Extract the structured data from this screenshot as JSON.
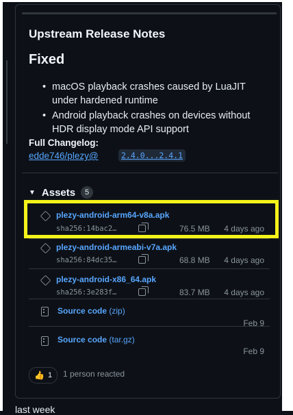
{
  "release": {
    "section_title": "Upstream Release Notes",
    "fixed_heading": "Fixed",
    "fixes": [
      "macOS playback crashes caused by LuaJIT under hardened runtime",
      "Android playback crashes on devices without HDR display mode API support"
    ],
    "changelog_label": "Full Changelog:",
    "changelog_repo": "edde746/plezy@",
    "changelog_compare": "2.4.0...2.4.1"
  },
  "assets": {
    "title": "Assets",
    "count": "5",
    "items": [
      {
        "name": "plezy-android-arm64-v8a.apk",
        "sha": "sha256:14bac2…",
        "size": "76.5 MB",
        "date": "4 days ago"
      },
      {
        "name": "plezy-android-armeabi-v7a.apk",
        "sha": "sha256:84dc35…",
        "size": "68.8 MB",
        "date": "4 days ago"
      },
      {
        "name": "plezy-android-x86_64.apk",
        "sha": "sha256:3e283f…",
        "size": "83.7 MB",
        "date": "4 days ago"
      }
    ],
    "sources": [
      {
        "label": "Source code",
        "format": "(zip)",
        "date": "Feb 9"
      },
      {
        "label": "Source code",
        "format": "(tar.gz)",
        "date": "Feb 9"
      }
    ]
  },
  "reactions": {
    "emoji": "👍",
    "count": "1",
    "text": "1 person reacted"
  },
  "footer": {
    "next_section": "last week"
  },
  "colors": {
    "background": "#0d1117",
    "link": "#58a6ff",
    "highlight": "#f4f31a"
  },
  "icons": [
    "package-icon",
    "copy-icon",
    "file-zip-icon",
    "thumbs-up-icon",
    "triangle-down-icon"
  ]
}
